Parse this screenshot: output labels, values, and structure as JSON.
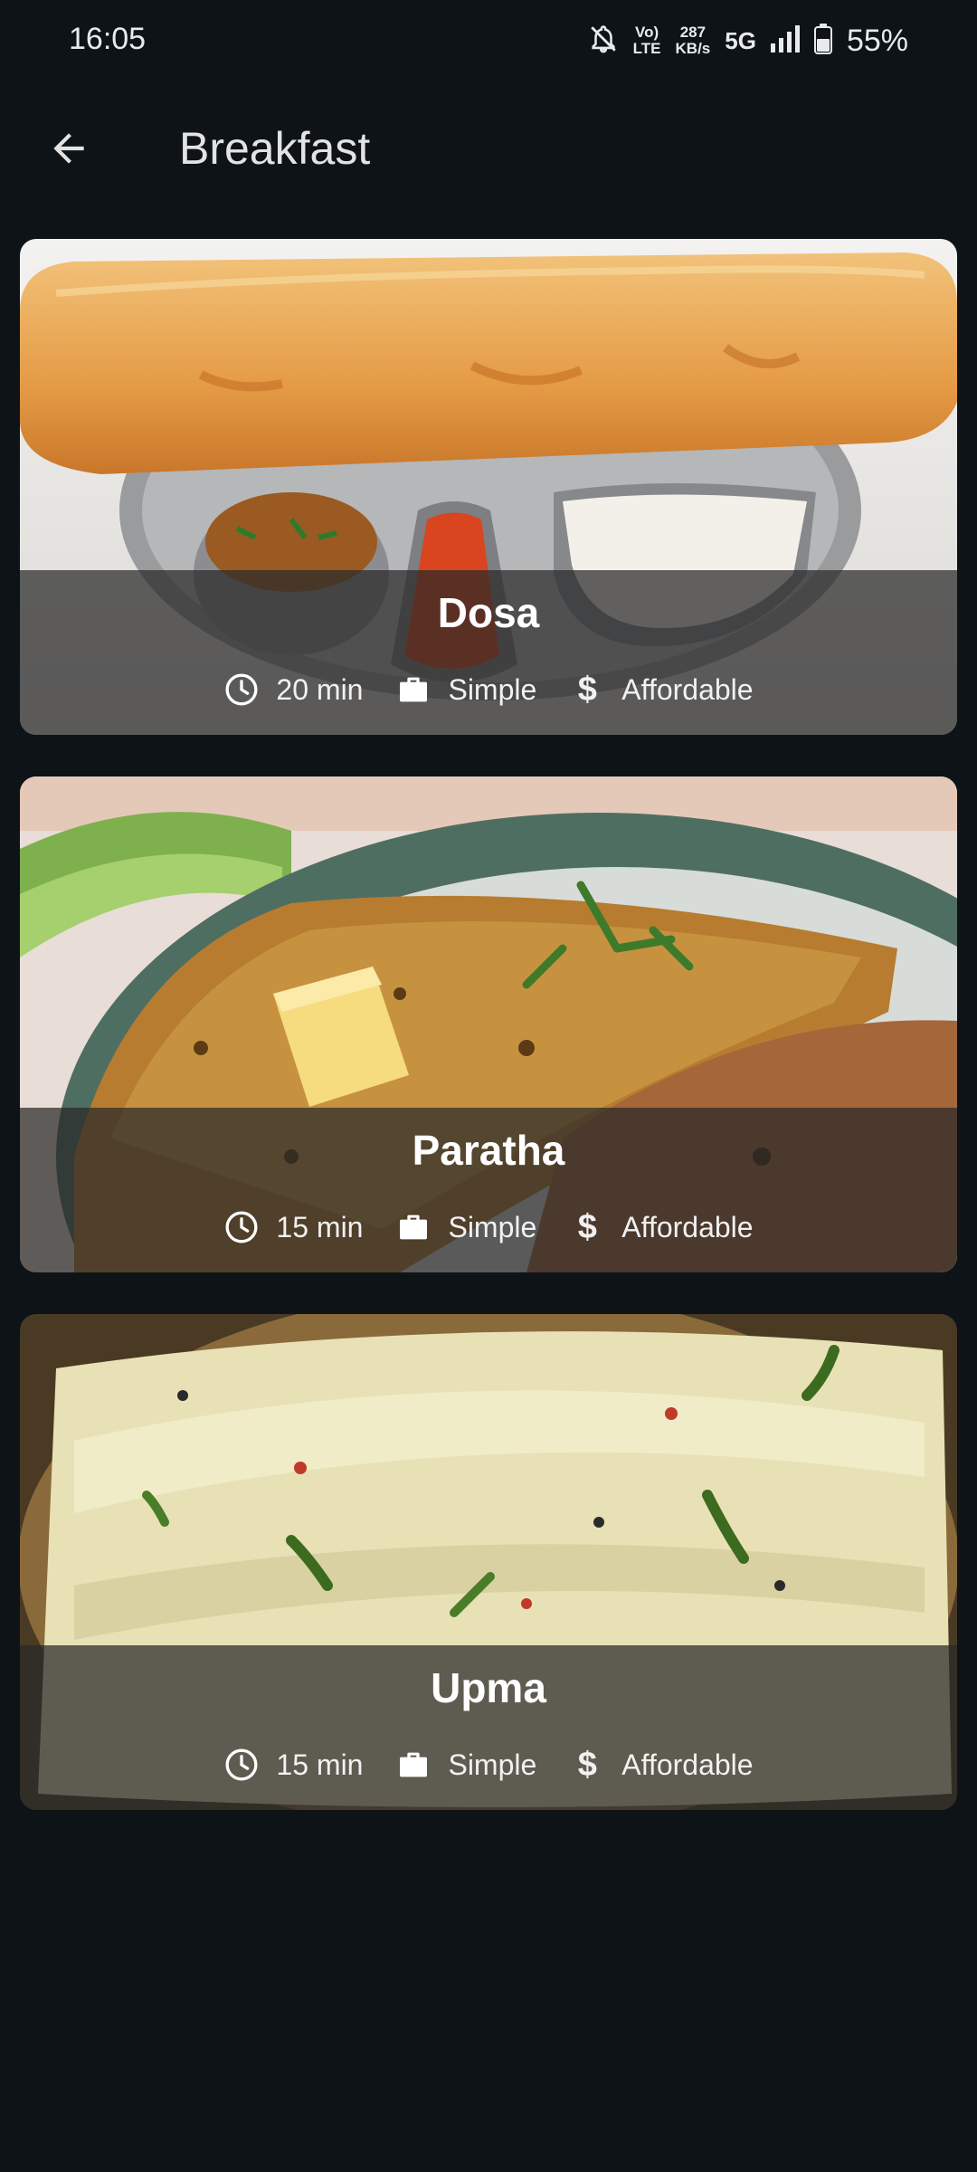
{
  "status_bar": {
    "time": "16:05",
    "network_speed_top": "287",
    "network_speed_bottom": "KB/s",
    "volte_top": "Vo)",
    "volte_bottom": "LTE",
    "network_type": "5G",
    "battery": "55%",
    "battery_level": 0.55
  },
  "app_bar": {
    "title": "Breakfast",
    "back_icon": "arrow-back-icon"
  },
  "meals": [
    {
      "title": "Dosa",
      "duration": "20 min",
      "complexity": "Simple",
      "affordability": "Affordable"
    },
    {
      "title": "Paratha",
      "duration": "15 min",
      "complexity": "Simple",
      "affordability": "Affordable"
    },
    {
      "title": "Upma",
      "duration": "15 min",
      "complexity": "Simple",
      "affordability": "Affordable"
    }
  ],
  "icons": {
    "duration": "clock-icon",
    "complexity": "briefcase-icon",
    "affordability": "dollar-icon"
  },
  "colors": {
    "background": "#0e1317",
    "overlay": "rgba(40,40,40,0.72)",
    "text": "#ffffff"
  }
}
